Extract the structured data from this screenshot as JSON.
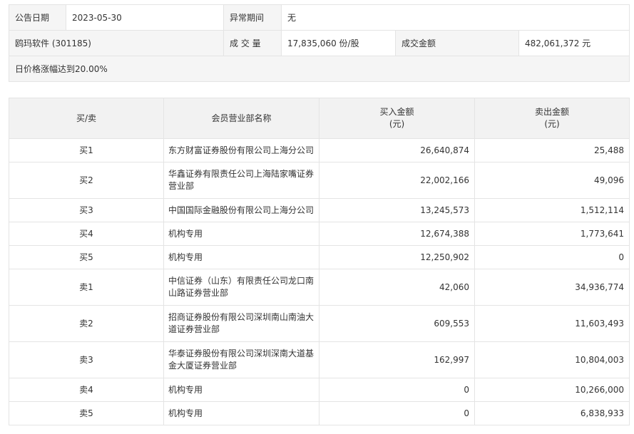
{
  "info": {
    "date_label": "公告日期",
    "date_value": "2023-05-30",
    "anomaly_label": "异常期间",
    "anomaly_value": "无",
    "stock": "鸥玛软件 (301185)",
    "volume_label": "成 交 量",
    "volume_value": "17,835,060 份/股",
    "amount_label": "成交金额",
    "amount_value": "482,061,372 元",
    "note": "日价格涨幅达到20.00%"
  },
  "table": {
    "headers": {
      "side": "买/卖",
      "name": "会员营业部名称",
      "buy_line1": "买入金额",
      "buy_line2": "(元)",
      "sell_line1": "卖出金额",
      "sell_line2": "(元)"
    },
    "rows": [
      {
        "side": "买1",
        "name": "东方财富证券股份有限公司上海分公司",
        "buy": "26,640,874",
        "sell": "25,488"
      },
      {
        "side": "买2",
        "name": "华鑫证券有限责任公司上海陆家嘴证券营业部",
        "buy": "22,002,166",
        "sell": "49,096"
      },
      {
        "side": "买3",
        "name": "中国国际金融股份有限公司上海分公司",
        "buy": "13,245,573",
        "sell": "1,512,114"
      },
      {
        "side": "买4",
        "name": "机构专用",
        "buy": "12,674,388",
        "sell": "1,773,641"
      },
      {
        "side": "买5",
        "name": "机构专用",
        "buy": "12,250,902",
        "sell": "0"
      },
      {
        "side": "卖1",
        "name": "中信证券（山东）有限责任公司龙口南山路证券营业部",
        "buy": "42,060",
        "sell": "34,936,774"
      },
      {
        "side": "卖2",
        "name": "招商证券股份有限公司深圳南山南油大道证券营业部",
        "buy": "609,553",
        "sell": "11,603,493"
      },
      {
        "side": "卖3",
        "name": "华泰证券股份有限公司深圳深南大道基金大厦证券营业部",
        "buy": "162,997",
        "sell": "10,804,003"
      },
      {
        "side": "卖4",
        "name": "机构专用",
        "buy": "0",
        "sell": "10,266,000"
      },
      {
        "side": "卖5",
        "name": "机构专用",
        "buy": "0",
        "sell": "6,838,933"
      }
    ]
  }
}
